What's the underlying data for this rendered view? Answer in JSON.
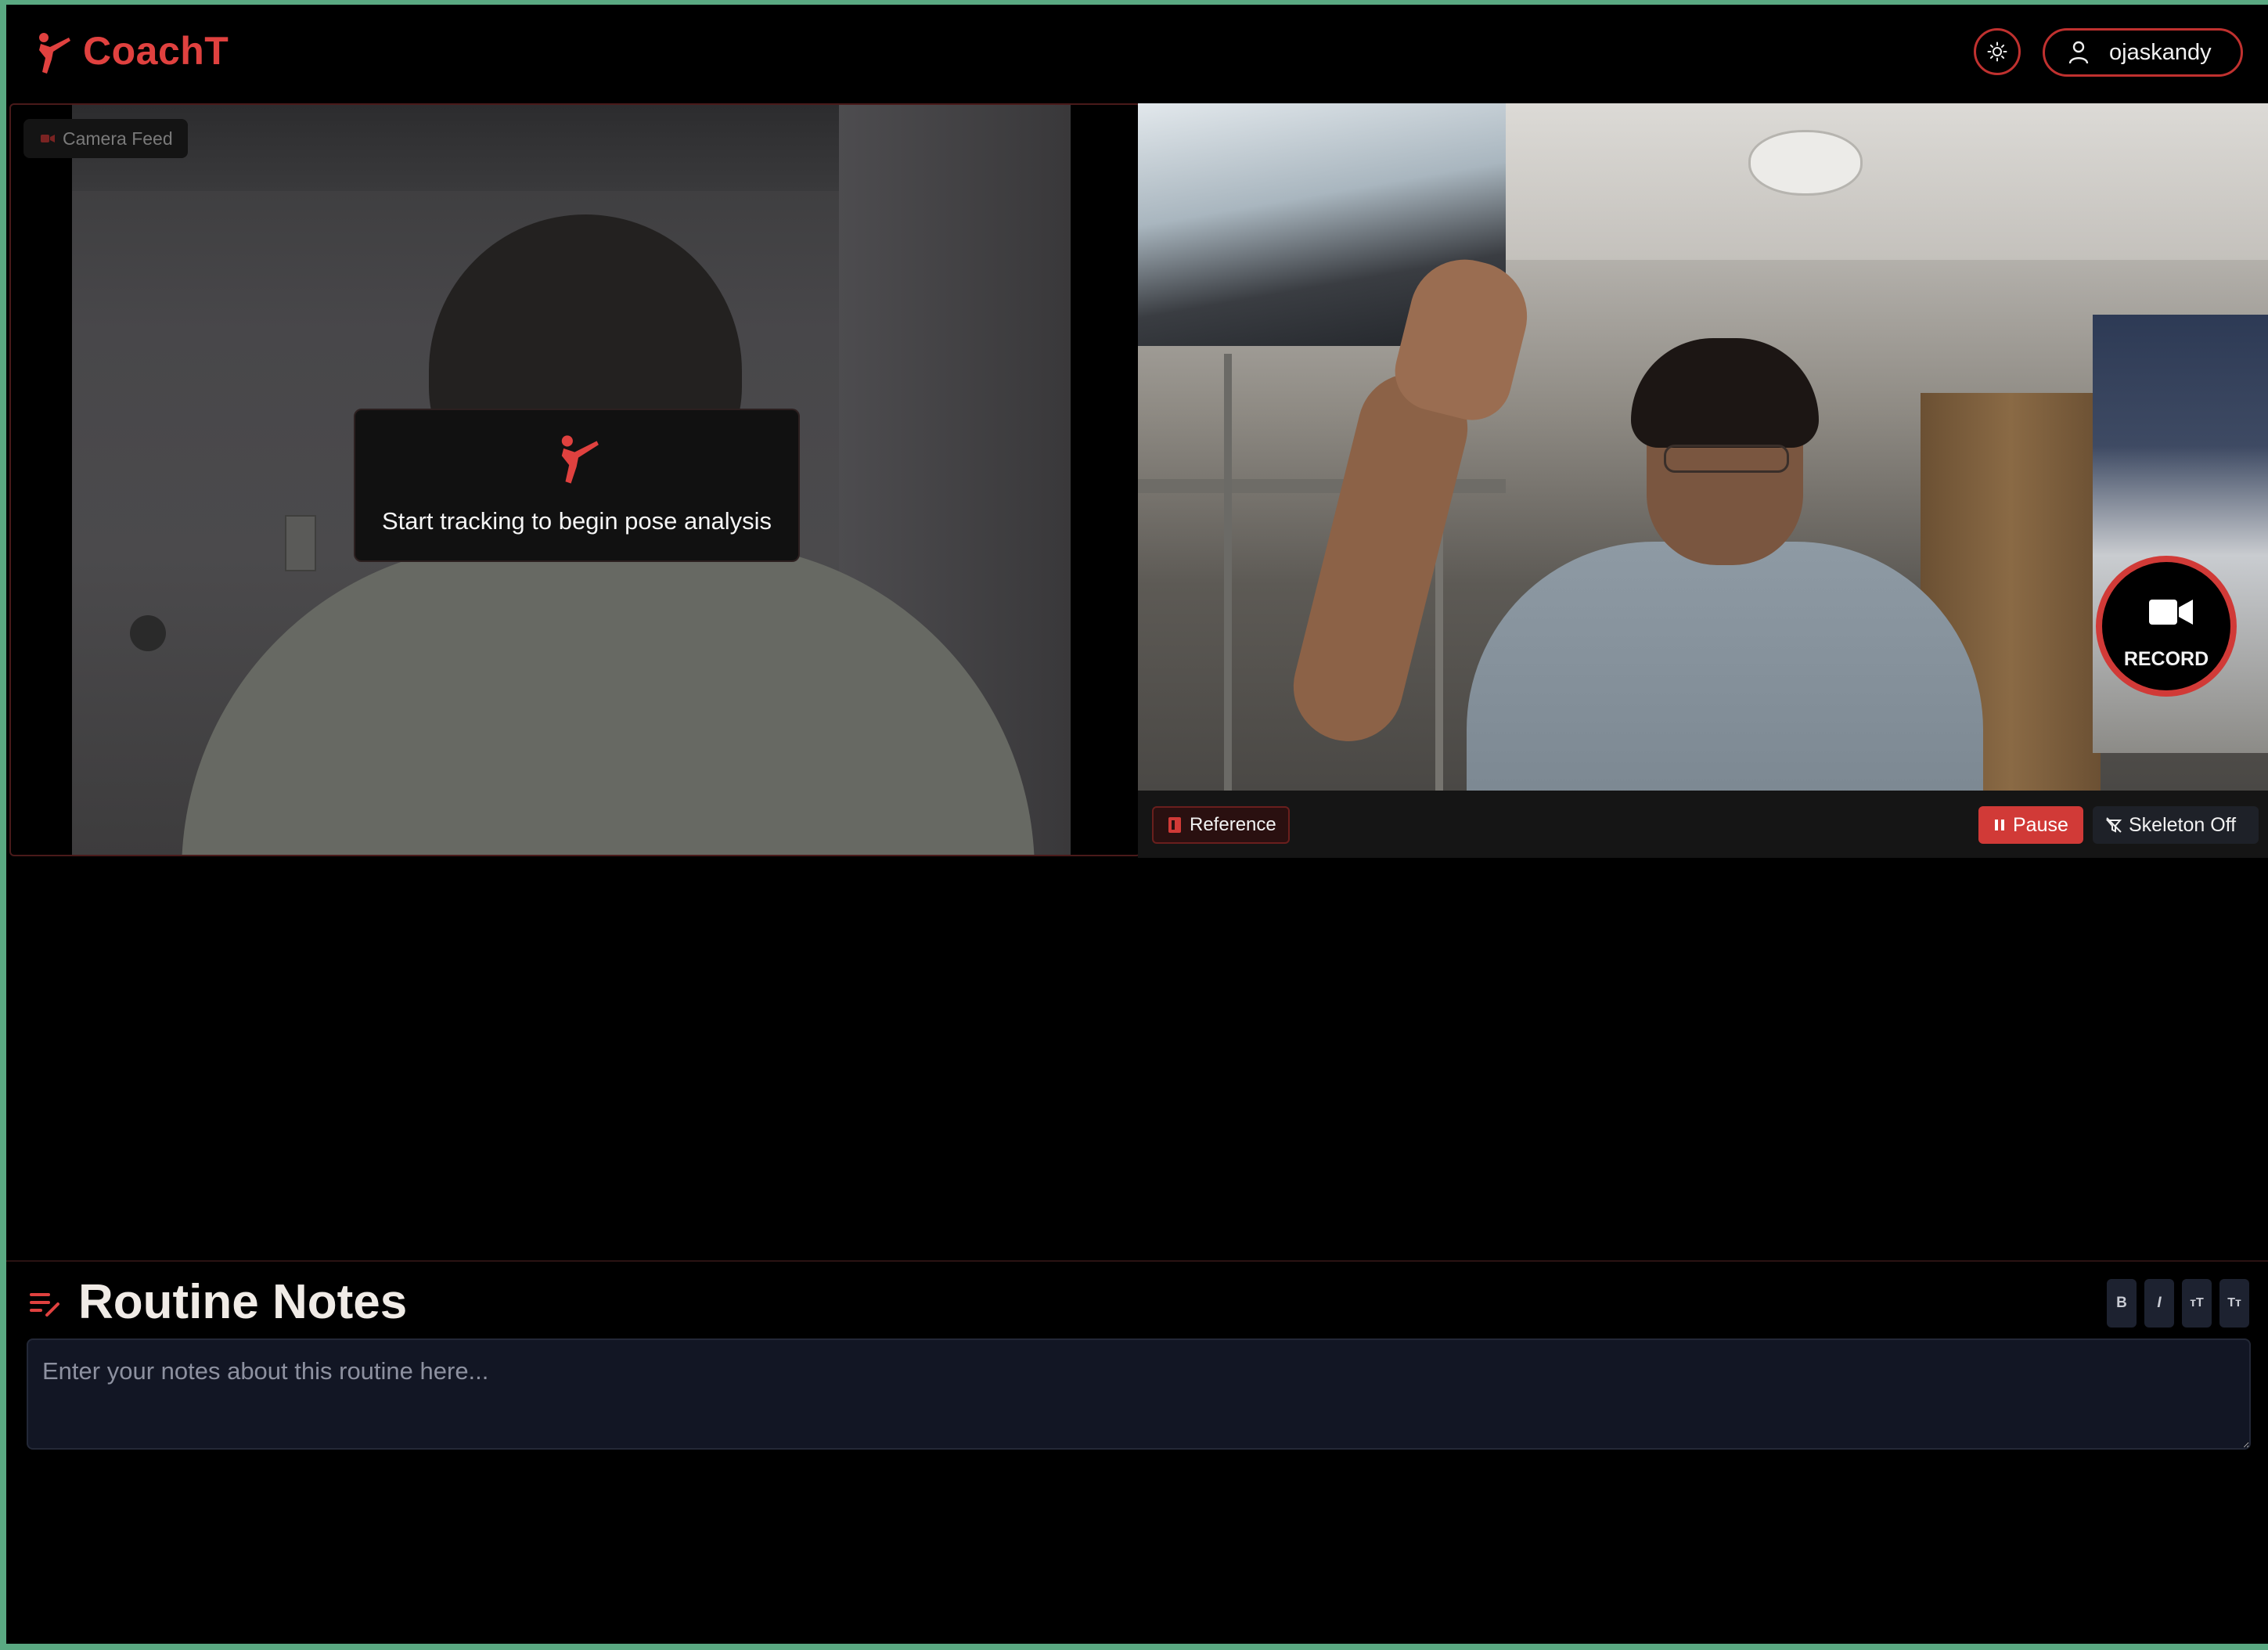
{
  "app": {
    "brand": "CoachT",
    "username": "ojaskandy"
  },
  "camera_feed": {
    "label": "Camera Feed",
    "overlay_message": "Start tracking to begin pose analysis"
  },
  "reference_feed": {
    "record_label": "RECORD",
    "reference_label": "Reference",
    "pause_label": "Pause",
    "skeleton_label": "Skeleton Off"
  },
  "notes": {
    "title": "Routine Notes",
    "placeholder": "Enter your notes about this routine here...",
    "toolbar": [
      "B",
      "I",
      "ᴛT",
      "Tт"
    ]
  },
  "colors": {
    "accent": "#d13a37",
    "background": "#000000",
    "frame": "#5aa982"
  },
  "icons": {
    "logo": "martial-arts-kick-icon",
    "theme": "sun-icon",
    "user": "user-icon",
    "camera": "video-camera-icon",
    "reference": "book-icon",
    "pause": "pause-icon",
    "skeleton": "skeleton-off-icon",
    "notes": "notes-edit-icon"
  }
}
